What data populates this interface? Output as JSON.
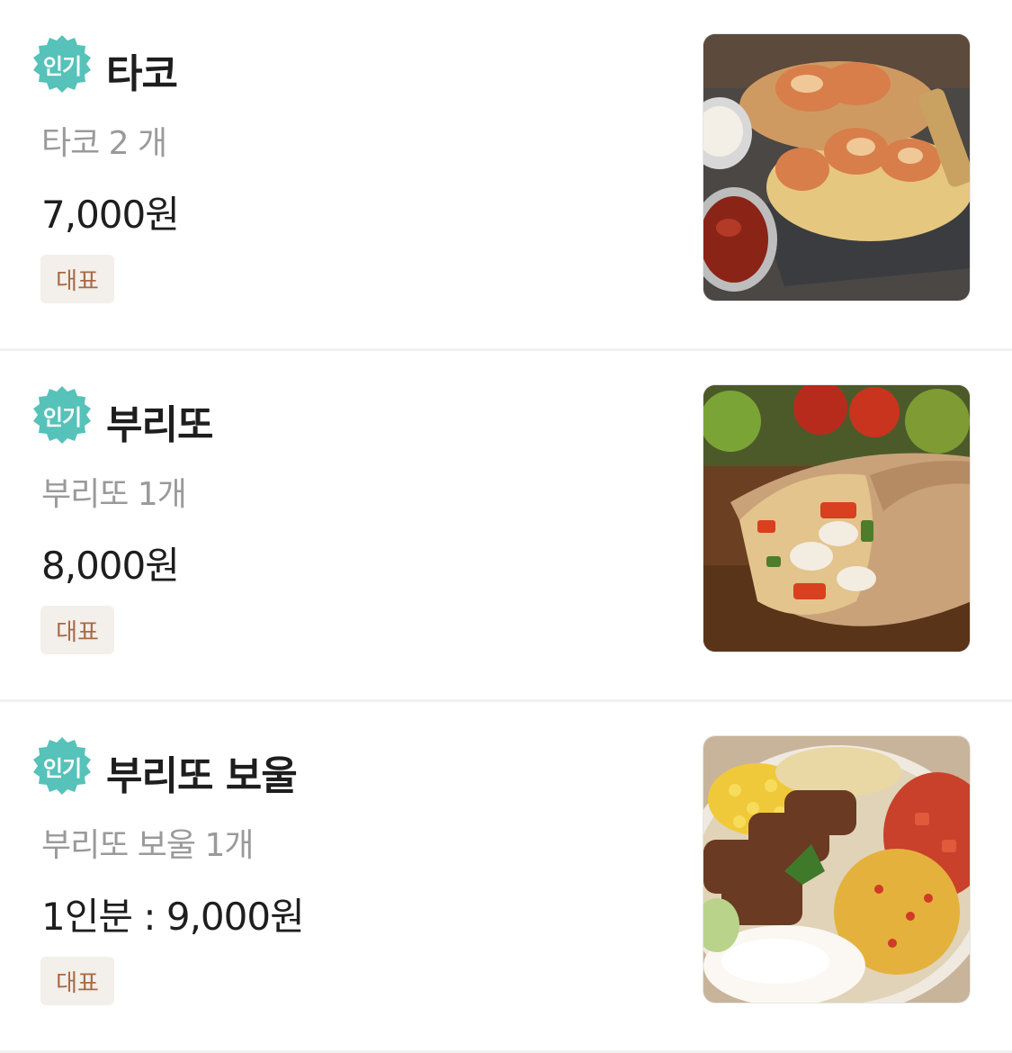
{
  "menu": {
    "items": [
      {
        "badge": "인기",
        "name": "타코",
        "description": "타코 2 개",
        "price": "7,000원",
        "tag": "대표",
        "image_icon": "taco-photo"
      },
      {
        "badge": "인기",
        "name": "부리또",
        "description": "부리또 1개",
        "price": "8,000원",
        "tag": "대표",
        "image_icon": "burrito-photo"
      },
      {
        "badge": "인기",
        "name": "부리또 보울",
        "description": "부리또 보울 1개",
        "price": "1인분 : 9,000원",
        "tag": "대표",
        "image_icon": "burrito-bowl-photo"
      }
    ]
  },
  "colors": {
    "badge_bg": "#56c2b9",
    "tag_bg": "#f3efea",
    "tag_text": "#a86a44",
    "description_text": "#9a9a9a",
    "divider": "#f1f1f1"
  }
}
